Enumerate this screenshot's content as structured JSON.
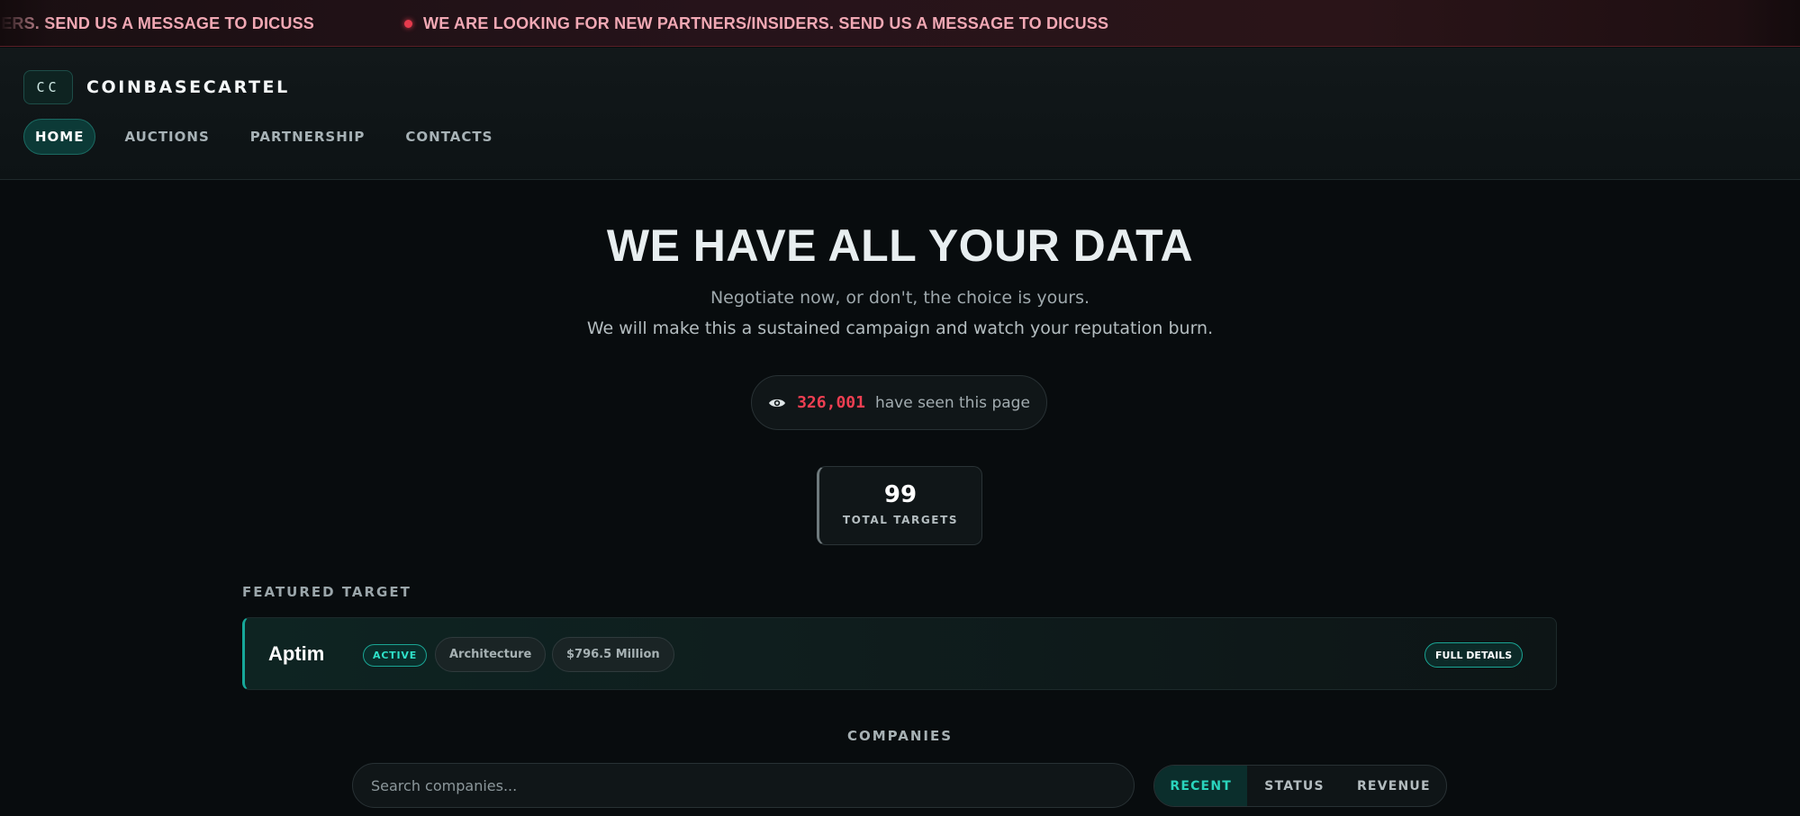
{
  "ticker": {
    "items": [
      "DERS. SEND US A MESSAGE TO DICUSS",
      "WE ARE LOOKING FOR NEW PARTNERS/INSIDERS. SEND US A MESSAGE TO DICUSS"
    ]
  },
  "header": {
    "logo_text": "CC",
    "brand": "COINBASECARTEL",
    "nav": [
      "HOME",
      "AUCTIONS",
      "PARTNERSHIP",
      "CONTACTS"
    ],
    "active_nav": "HOME"
  },
  "hero": {
    "title": "WE HAVE ALL YOUR DATA",
    "subtitle_1": "Negotiate now, or don't, the choice is yours.",
    "subtitle_2": "We will make this a sustained campaign and watch your reputation burn.",
    "views_count": "326,001",
    "views_label": "have seen this page"
  },
  "stats": {
    "total_targets_value": "99",
    "total_targets_label": "TOTAL TARGETS"
  },
  "featured": {
    "section_label": "FEATURED TARGET",
    "name": "Aptim",
    "status": "ACTIVE",
    "industry": "Architecture",
    "revenue": "$796.5 Million",
    "details_label": "FULL DETAILS"
  },
  "companies": {
    "section_label": "COMPANIES",
    "search_placeholder": "Search companies...",
    "sort_options": [
      "RECENT",
      "STATUS",
      "REVENUE"
    ],
    "active_sort": "RECENT"
  },
  "colors": {
    "accent_teal": "#2ee0c8",
    "alert_red": "#ef3f52",
    "ticker_text": "#f1a8b4"
  },
  "icons": {
    "views": "eye-icon",
    "ticker_bullet": "red-dot-icon"
  }
}
